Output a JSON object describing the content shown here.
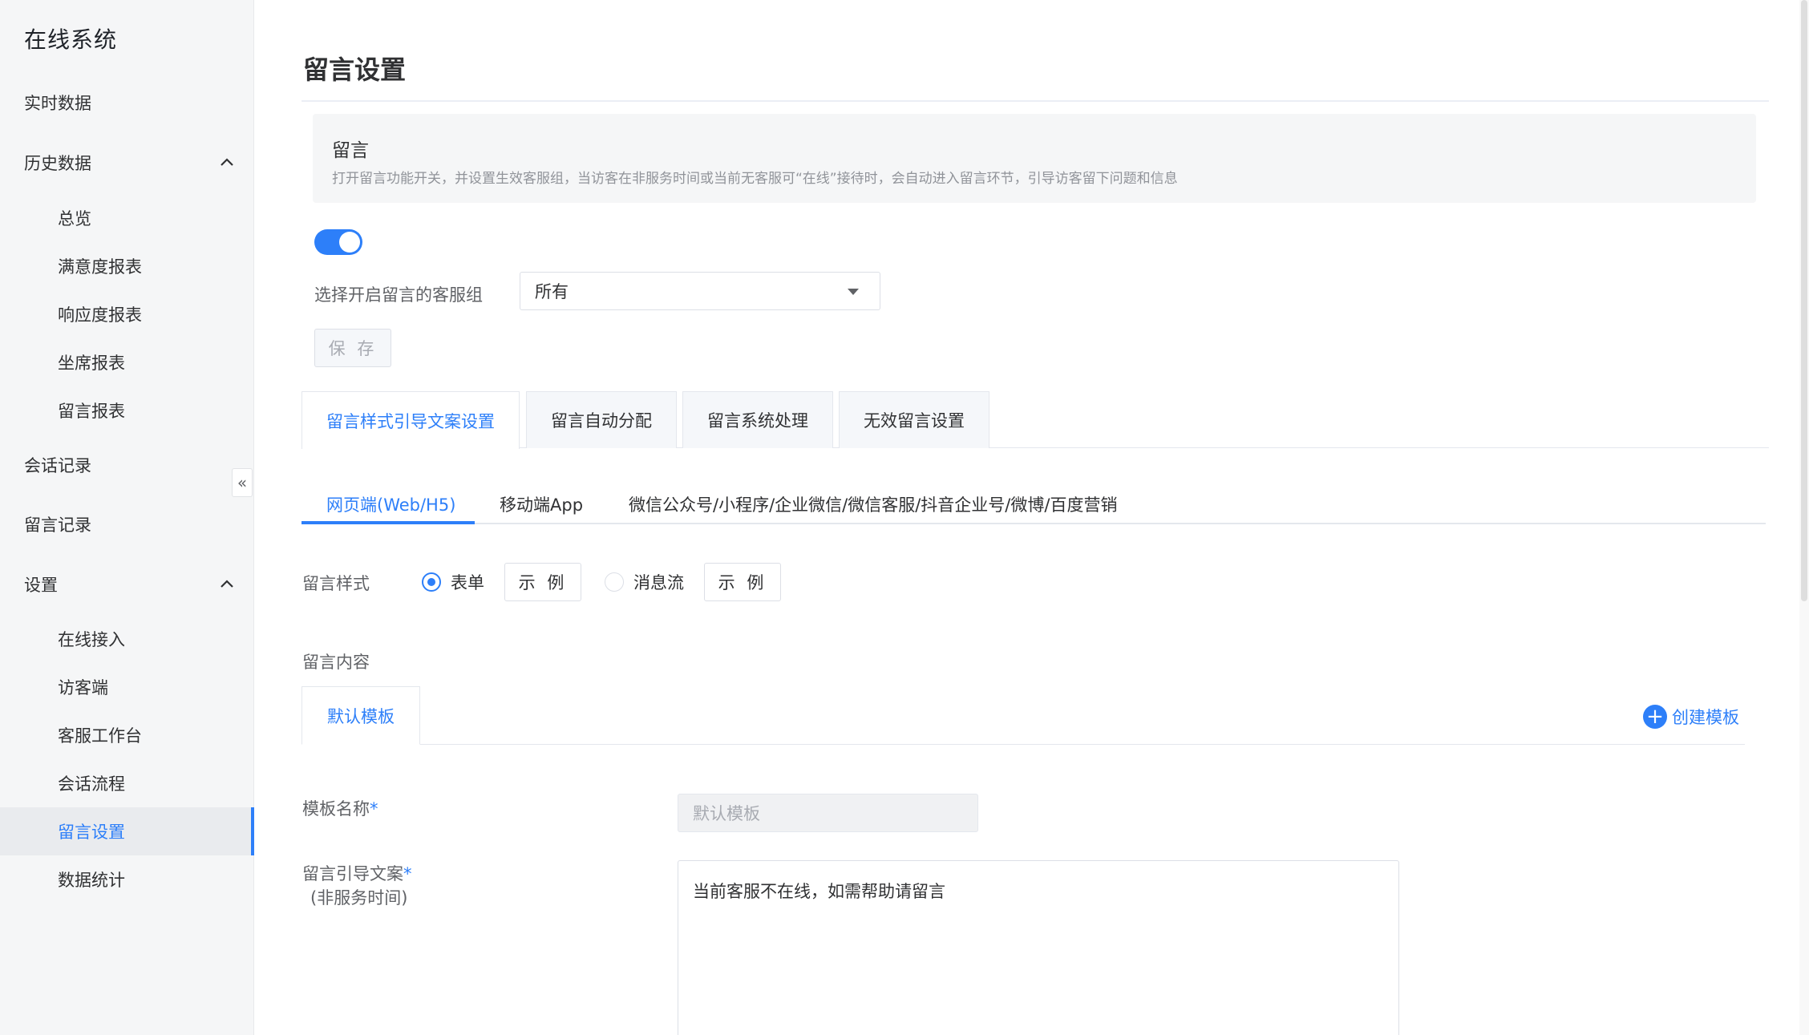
{
  "app": {
    "title": "在线系统"
  },
  "sidebar": {
    "realtime": "实时数据",
    "history": {
      "label": "历史数据",
      "items": [
        "总览",
        "满意度报表",
        "响应度报表",
        "坐席报表",
        "留言报表"
      ]
    },
    "sessions": "会话记录",
    "messages": "留言记录",
    "settings": {
      "label": "设置",
      "items": [
        "在线接入",
        "访客端",
        "客服工作台",
        "会话流程",
        "留言设置",
        "数据统计"
      ]
    },
    "active_item": "留言设置",
    "collapse_glyph": "«"
  },
  "page": {
    "title": "留言设置",
    "section": {
      "title": "留言",
      "description": "打开留言功能开关，并设置生效客服组，当访客在非服务时间或当前无客服可“在线”接待时，会自动进入留言环节，引导访客留下问题和信息"
    },
    "switch_on": true,
    "group_label": "选择开启留言的客服组",
    "group_value": "所有",
    "save_label": "保 存",
    "tabs": [
      "留言样式引导文案设置",
      "留言自动分配",
      "留言系统处理",
      "无效留言设置"
    ],
    "active_tab": "留言样式引导文案设置",
    "sub_tabs": [
      "网页端(Web/H5)",
      "移动端App",
      "微信公众号/小程序/企业微信/微信客服/抖音企业号/微博/百度营销"
    ],
    "active_sub_tab": "网页端(Web/H5)",
    "style_label": "留言样式",
    "style_options": [
      {
        "label": "表单",
        "checked": true
      },
      {
        "label": "消息流",
        "checked": false
      }
    ],
    "example_label": "示 例",
    "content_label": "留言内容",
    "template_tab": "默认模板",
    "create_template": "创建模板",
    "template_name_label": "模板名称",
    "required_mark": "*",
    "template_name_placeholder": "默认模板",
    "guide_label_line1": "留言引导文案",
    "guide_label_line2": "(非服务时间)",
    "guide_text": "当前客服不在线，如需帮助请留言"
  },
  "colors": {
    "accent": "#2d7ff9",
    "sidebar_bg": "#f5f6f7"
  }
}
